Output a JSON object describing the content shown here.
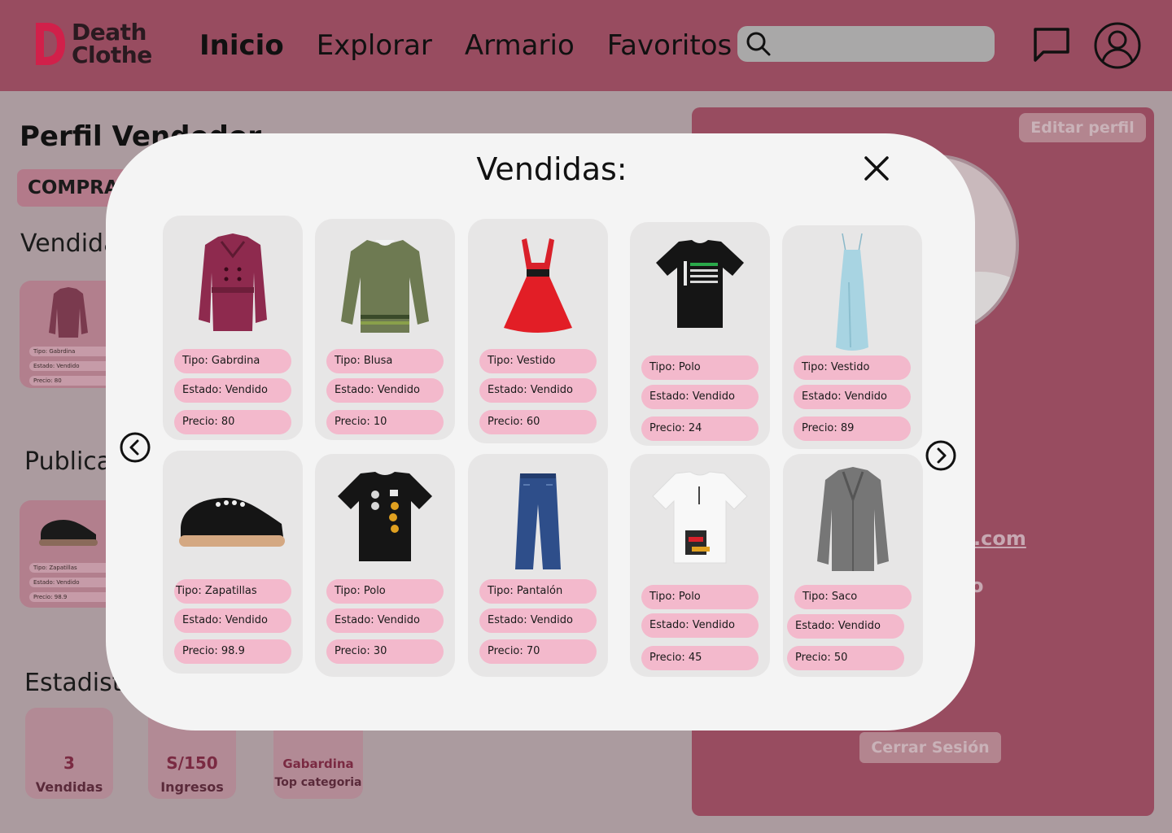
{
  "app": {
    "logo_line1": "Death",
    "logo_line2": "Clothe",
    "colors": {
      "header": "#984c60",
      "accent": "#d1204a",
      "pill": "#f3b9cc",
      "modal_bg": "#f4f4f4"
    }
  },
  "nav": [
    "Inicio",
    "Explorar",
    "Armario",
    "Favoritos"
  ],
  "search": {
    "placeholder": ""
  },
  "icons": {
    "search": "search-icon",
    "chat": "chat-icon",
    "user": "user-icon"
  },
  "page": {
    "title": "Perfil Vendedor",
    "role_tab": "COMPRADOR",
    "sections": {
      "vendidas": "Vendidas",
      "publicadas": "Publicadas",
      "estadisticas": "Estadisticas"
    },
    "mini_vendida": [
      "Tipo: Gabrdina",
      "Estado: Vendido",
      "Precio: 80"
    ],
    "mini_publicada": [
      "Tipo: Zapatillas",
      "Estado: Vendido",
      "Precio: 98.9"
    ],
    "stats": [
      {
        "value": "3",
        "label": "Vendidas"
      },
      {
        "value": "S/150",
        "label": "Ingresos"
      },
      {
        "value": "Gabardina",
        "label": "Top categoria"
      }
    ],
    "profile": {
      "edit_button": "Editar perfil",
      "email_fragment": ".com",
      "other_fragment": "o",
      "logout_button": "Cerrar Sesión"
    }
  },
  "modal": {
    "title": "Vendidas:",
    "items": [
      {
        "icon": "trench-coat-image",
        "tipo": "Tipo: Gabrdina",
        "estado": "Estado: Vendido",
        "precio": "Precio: 80"
      },
      {
        "icon": "blouse-image",
        "tipo": "Tipo: Blusa",
        "estado": "Estado: Vendido",
        "precio": "Precio: 10"
      },
      {
        "icon": "red-dress-image",
        "tipo": "Tipo: Vestido",
        "estado": "Estado: Vendido",
        "precio": "Precio: 60"
      },
      {
        "icon": "black-tshirt-image",
        "tipo": "Tipo: Polo",
        "estado": "Estado: Vendido",
        "precio": "Precio: 24"
      },
      {
        "icon": "slip-dress-image",
        "tipo": "Tipo: Vestido",
        "estado": "Estado: Vendido",
        "precio": "Precio: 89"
      },
      {
        "icon": "sneaker-image",
        "tipo": "Tipo: Zapatillas",
        "estado": "Estado: Vendido",
        "precio": "Precio: 98.9"
      },
      {
        "icon": "graphic-tshirt-image",
        "tipo": "Tipo: Polo",
        "estado": "Estado: Vendido",
        "precio": "Precio: 30"
      },
      {
        "icon": "jeans-image",
        "tipo": "Tipo: Pantalón",
        "estado": "Estado: Vendido",
        "precio": "Precio: 70"
      },
      {
        "icon": "white-tshirt-image",
        "tipo": "Tipo: Polo",
        "estado": "Estado: Vendido",
        "precio": "Precio: 45"
      },
      {
        "icon": "grey-coat-image",
        "tipo": "Tipo: Saco",
        "estado": "Estado: Vendido",
        "precio": "Precio: 50"
      }
    ]
  }
}
